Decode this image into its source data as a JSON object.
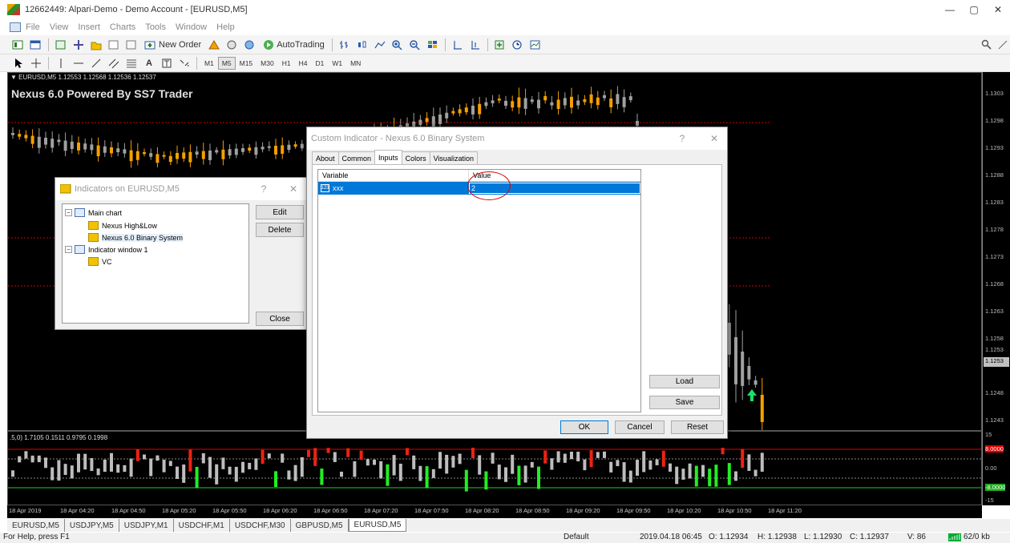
{
  "window": {
    "title": "12662449: Alpari-Demo - Demo Account - [EURUSD,M5]",
    "minimize": "—",
    "maximize": "▢",
    "close": "✕"
  },
  "menu": [
    "File",
    "View",
    "Insert",
    "Charts",
    "Tools",
    "Window",
    "Help"
  ],
  "toolbar": {
    "new_order": "New Order",
    "autotrading": "AutoTrading"
  },
  "timeframes": [
    "M1",
    "M5",
    "M15",
    "M30",
    "H1",
    "H4",
    "D1",
    "W1",
    "MN"
  ],
  "active_timeframe": "M5",
  "chart": {
    "header": "▼ EURUSD,M5  1.12553 1.12568 1.12536 1.12537",
    "title": "Nexus 6.0 Powered By SS7 Trader",
    "price_labels": [
      "1.1303",
      "1.1298",
      "1.1293",
      "1.1288",
      "1.1283",
      "1.1278",
      "1.1273",
      "1.1268",
      "1.1263",
      "1.1258",
      "1.1253",
      "1.1248",
      "1.1243"
    ],
    "current_price": "1.1253",
    "bull_color": "#f5a000",
    "bear_color": "#a0a0a0"
  },
  "subwindow": {
    "label": ".5,0) 1.7105 0.1511 0.9795 0.1998",
    "axis_labels": [
      "15",
      "8.0000",
      "0.00",
      "-8.0000",
      "-15"
    ]
  },
  "time_labels": [
    "18 Apr 2019",
    "18 Apr 04:20",
    "18 Apr 04:50",
    "18 Apr 05:20",
    "18 Apr 05:50",
    "18 Apr 06:20",
    "18 Apr 06:50",
    "18 Apr 07:20",
    "18 Apr 07:50",
    "18 Apr 08:20",
    "18 Apr 08:50",
    "18 Apr 09:20",
    "18 Apr 09:50",
    "18 Apr 10:20",
    "18 Apr 10:50",
    "18 Apr 11:20"
  ],
  "symbol_tabs": [
    "EURUSD,M5",
    "USDJPY,M5",
    "USDJPY,M1",
    "USDCHF,M1",
    "USDCHF,M30",
    "GBPUSD,M5",
    "EURUSD,M5"
  ],
  "status": {
    "help": "For Help, press F1",
    "profile": "Default",
    "datetime": "2019.04.18 06:45",
    "open": "O: 1.12934",
    "high": "H: 1.12938",
    "low": "L: 1.12930",
    "close": "C: 1.12937",
    "volume": "V: 86",
    "traffic": "62/0 kb"
  },
  "indicators_dialog": {
    "title": "Indicators on EURUSD,M5",
    "help": "?",
    "close_x": "✕",
    "tree": {
      "main_chart": "Main chart",
      "item1": "Nexus High&Low",
      "item2": "Nexus 6.0 Binary System",
      "indicator_window": "Indicator window 1",
      "item3": "VC"
    },
    "edit": "Edit",
    "delete": "Delete",
    "close": "Close"
  },
  "custom_dialog": {
    "title": "Custom Indicator - Nexus 6.0 Binary System",
    "help": "?",
    "close_x": "✕",
    "tabs": [
      "About",
      "Common",
      "Inputs",
      "Colors",
      "Visualization"
    ],
    "active_tab": "Inputs",
    "col_variable": "Variable",
    "col_value": "Value",
    "param_type": "123",
    "param_name": "xxx",
    "param_value": "2",
    "load": "Load",
    "save": "Save",
    "ok": "OK",
    "cancel": "Cancel",
    "reset": "Reset"
  }
}
